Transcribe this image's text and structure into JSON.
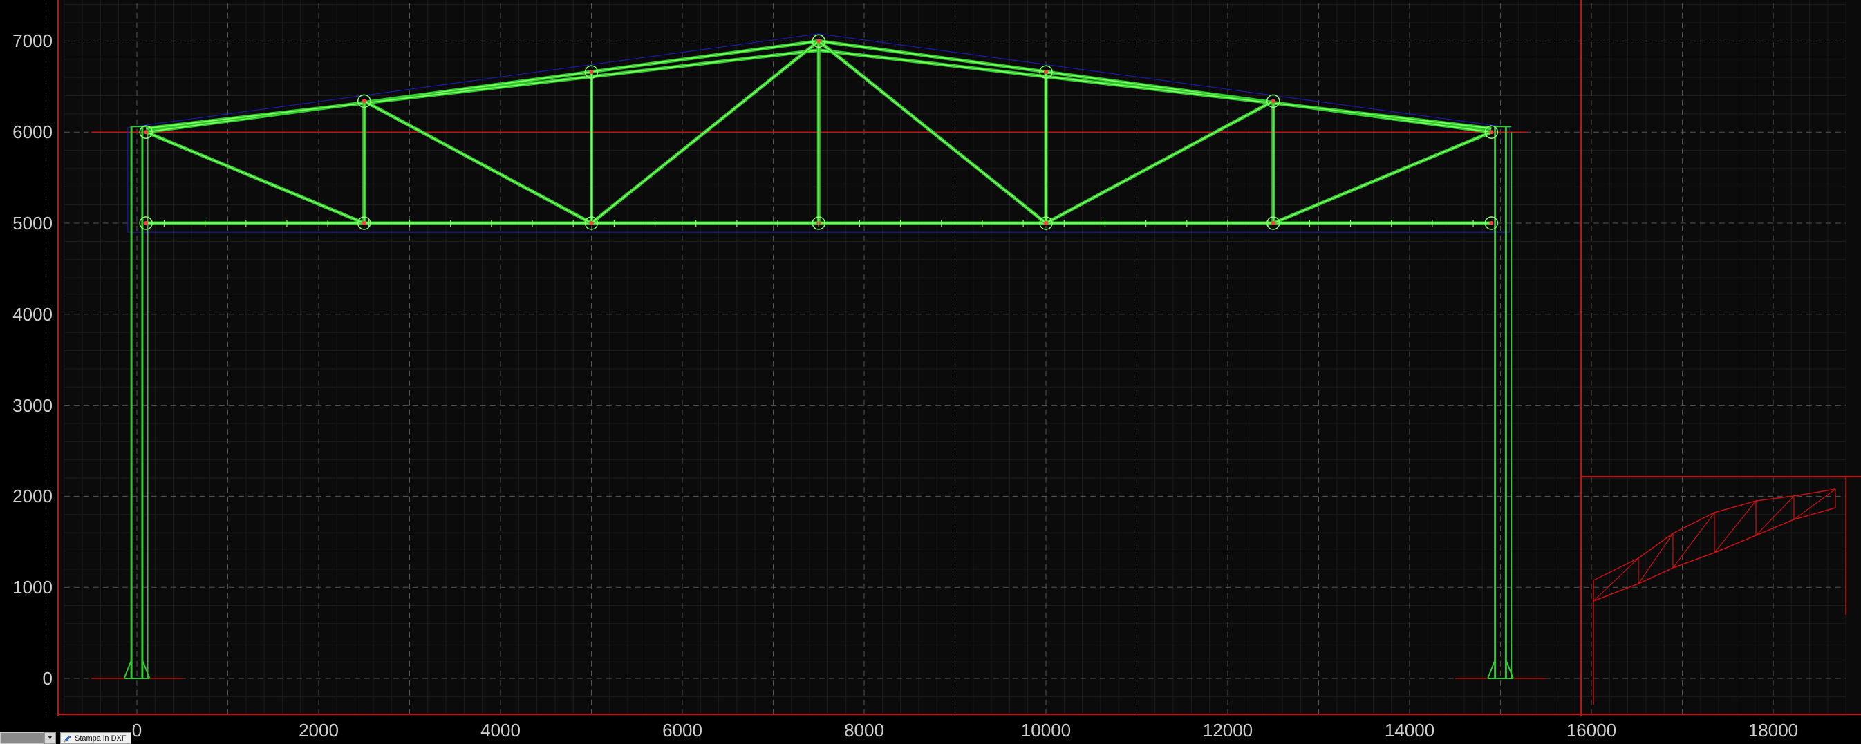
{
  "canvas": {
    "background": "#0b0b0b",
    "grid_major_color": "#555555",
    "grid_minor_color": "#1c1c1c",
    "truss_color": "#2ecc2e",
    "truss_light_color": "#8cff6a",
    "outline_color": "#1a1aa8",
    "border_color": "#c81010",
    "node_color": "#ff4040"
  },
  "axes": {
    "x_ticks": [
      "0",
      "2000",
      "4000",
      "6000",
      "8000",
      "10000",
      "12000",
      "14000",
      "16000",
      "18000"
    ],
    "y_ticks": [
      "7000",
      "6000",
      "5000",
      "4000",
      "3000",
      "2000",
      "1000",
      "0"
    ],
    "x_range": [
      -900,
      18800
    ],
    "y_range": [
      -400,
      7450
    ]
  },
  "footer": {
    "print_dxf_label": "Stampa in DXF"
  }
}
